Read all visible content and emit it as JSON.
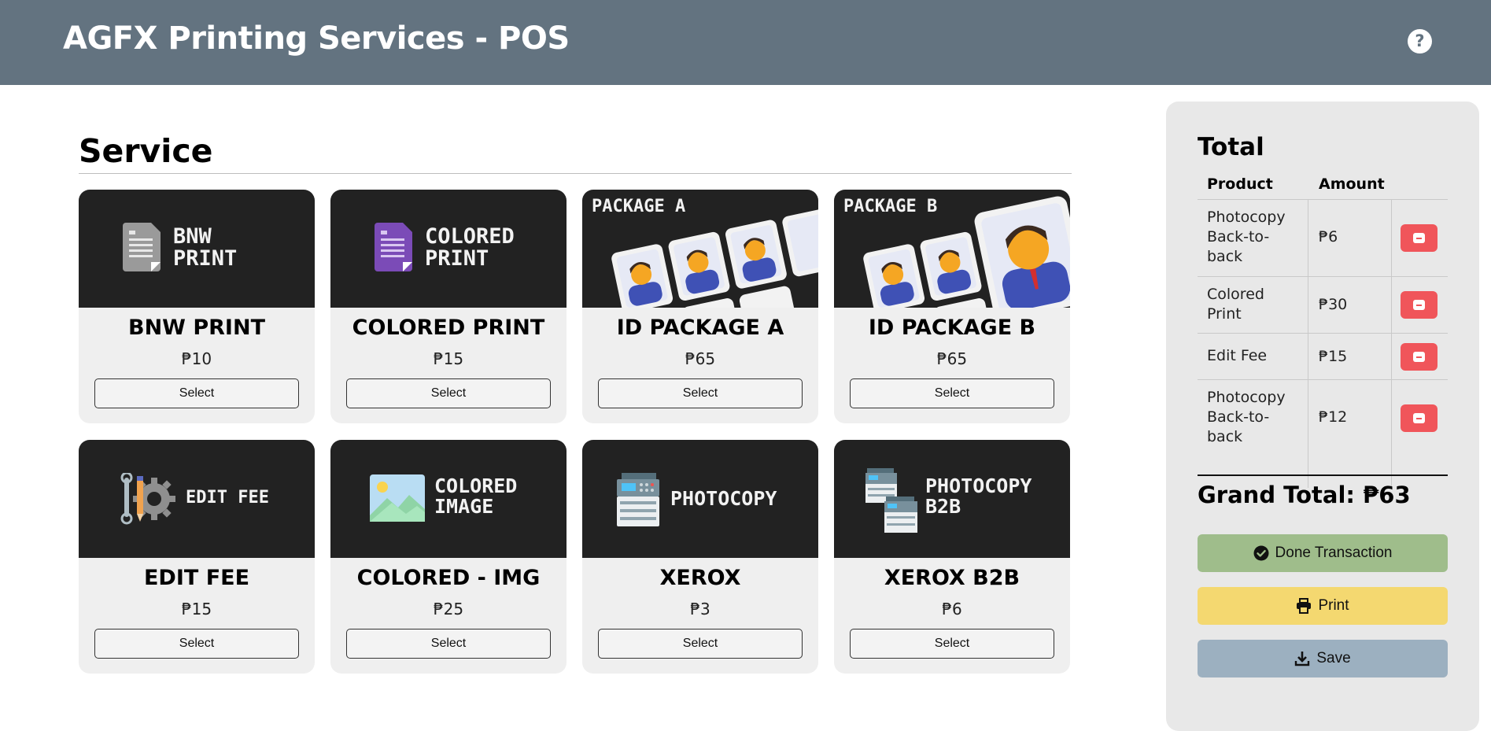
{
  "header": {
    "title": "AGFX Printing Services - POS",
    "help_symbol": "?"
  },
  "section": {
    "title": "Service"
  },
  "services": [
    {
      "thumb_label": [
        "BNW",
        "PRINT"
      ],
      "thumb_icon": "document-icon",
      "name": "BNW PRINT",
      "price": "₱10",
      "select_label": "Select"
    },
    {
      "thumb_label": [
        "COLORED",
        "PRINT"
      ],
      "thumb_icon": "purple-document-icon",
      "name": "COLORED PRINT",
      "price": "₱15",
      "select_label": "Select"
    },
    {
      "thumb_label": [
        "PACKAGE A"
      ],
      "thumb_icon": "id-photos-icon",
      "name": "ID PACKAGE A",
      "price": "₱65",
      "select_label": "Select"
    },
    {
      "thumb_label": [
        "PACKAGE B"
      ],
      "thumb_icon": "id-photos-icon",
      "name": "ID PACKAGE B",
      "price": "₱65",
      "select_label": "Select"
    },
    {
      "thumb_label": [
        "EDIT FEE"
      ],
      "thumb_icon": "tools-gear-icon",
      "name": "EDIT FEE",
      "price": "₱15",
      "select_label": "Select"
    },
    {
      "thumb_label": [
        "COLORED",
        "IMAGE"
      ],
      "thumb_icon": "image-icon",
      "name": "COLORED - IMG",
      "price": "₱25",
      "select_label": "Select"
    },
    {
      "thumb_label": [
        "PHOTOCOPY"
      ],
      "thumb_icon": "copier-icon",
      "name": "XEROX",
      "price": "₱3",
      "select_label": "Select"
    },
    {
      "thumb_label": [
        "PHOTOCOPY",
        "B2B"
      ],
      "thumb_icon": "double-copier-icon",
      "name": "XEROX B2B",
      "price": "₱6",
      "select_label": "Select"
    }
  ],
  "cart": {
    "title": "Total",
    "headers": {
      "product": "Product",
      "amount": "Amount"
    },
    "items": [
      {
        "product": [
          "Photocopy",
          "Back-to-",
          "back"
        ],
        "amount": "₱6"
      },
      {
        "product": [
          "Colored",
          "Print"
        ],
        "amount": "₱30"
      },
      {
        "product": [
          "Edit Fee"
        ],
        "amount": "₱15"
      },
      {
        "product": [
          "Photocopy",
          "Back-to-",
          "back"
        ],
        "amount": "₱12"
      }
    ],
    "grand_total_label": "Grand Total: ₱63"
  },
  "actions": {
    "done_label": "Done Transaction",
    "print_label": "Print",
    "save_label": "Save"
  },
  "colors": {
    "header_bg": "#637380",
    "card_bg": "#efefef",
    "thumb_bg": "#222222",
    "delete_red": "#f0555a",
    "done_green": "#9fbd8b",
    "print_yellow": "#f4d870",
    "save_blue": "#9cb0c0"
  }
}
